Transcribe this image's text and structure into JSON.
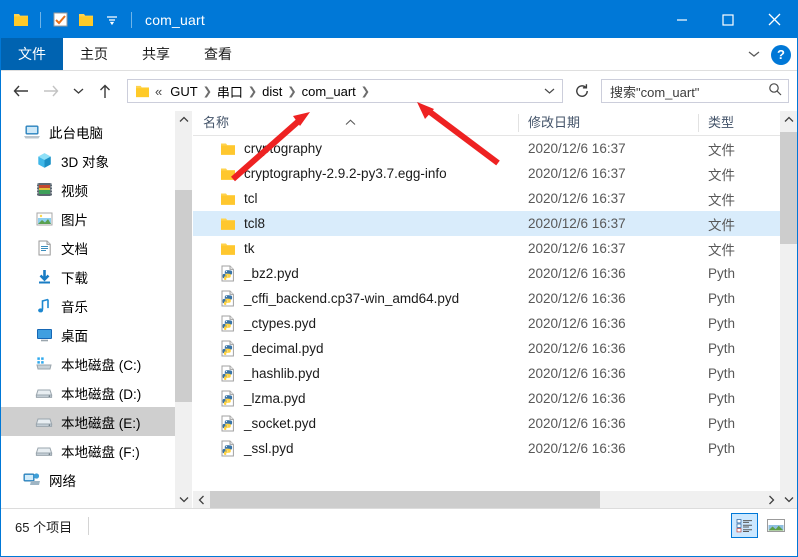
{
  "window": {
    "title": "com_uart",
    "quick_access": [
      {
        "name": "folder-icon",
        "label": "文件夹"
      },
      {
        "name": "properties-icon",
        "label": "属性"
      },
      {
        "name": "new-folder-icon",
        "label": "新建文件夹"
      },
      {
        "name": "customize-qat-icon",
        "label": "自定义快速访问工具栏"
      }
    ],
    "controls": {
      "minimize": "最小化",
      "maximize": "最大化",
      "close": "关闭"
    }
  },
  "ribbon": {
    "tabs": [
      {
        "label": "文件",
        "active": true
      },
      {
        "label": "主页",
        "active": false
      },
      {
        "label": "共享",
        "active": false
      },
      {
        "label": "查看",
        "active": false
      }
    ],
    "collapse_label": "折叠功能区",
    "help_label": "?"
  },
  "navbar": {
    "back": "后退",
    "forward": "前进",
    "recent": "最近使用的位置",
    "up": "向上",
    "refresh": "刷新",
    "breadcrumb": {
      "overflow": "«",
      "items": [
        "GUT",
        "串口",
        "dist",
        "com_uart"
      ]
    },
    "dropdown": "历史记录"
  },
  "search": {
    "placeholder": "搜索\"com_uart\"",
    "icon": "search-icon"
  },
  "sidebar": {
    "items": [
      {
        "label": "此台电脑",
        "icon": "computer-icon",
        "indent": 0,
        "selected": false
      },
      {
        "label": "3D 对象",
        "icon": "3d-objects-icon",
        "indent": 1,
        "selected": false
      },
      {
        "label": "视频",
        "icon": "videos-icon",
        "indent": 1,
        "selected": false
      },
      {
        "label": "图片",
        "icon": "pictures-icon",
        "indent": 1,
        "selected": false
      },
      {
        "label": "文档",
        "icon": "documents-icon",
        "indent": 1,
        "selected": false
      },
      {
        "label": "下载",
        "icon": "downloads-icon",
        "indent": 1,
        "selected": false
      },
      {
        "label": "音乐",
        "icon": "music-icon",
        "indent": 1,
        "selected": false
      },
      {
        "label": "桌面",
        "icon": "desktop-icon",
        "indent": 1,
        "selected": false
      },
      {
        "label": "本地磁盘 (C:)",
        "icon": "windows-drive-icon",
        "indent": 1,
        "selected": false
      },
      {
        "label": "本地磁盘 (D:)",
        "icon": "drive-icon",
        "indent": 1,
        "selected": false
      },
      {
        "label": "本地磁盘 (E:)",
        "icon": "drive-icon",
        "indent": 1,
        "selected": true
      },
      {
        "label": "本地磁盘 (F:)",
        "icon": "drive-icon",
        "indent": 1,
        "selected": false
      },
      {
        "label": "网络",
        "icon": "network-icon",
        "indent": 0,
        "selected": false
      }
    ]
  },
  "filelist": {
    "columns": [
      {
        "label": "名称",
        "key": "name",
        "sorted": "asc"
      },
      {
        "label": "修改日期",
        "key": "date"
      },
      {
        "label": "类型",
        "key": "type"
      }
    ],
    "rows": [
      {
        "name": "cryptography",
        "date": "2020/12/6 16:37",
        "type": "文件",
        "icon": "folder-icon",
        "selected": false
      },
      {
        "name": "cryptography-2.9.2-py3.7.egg-info",
        "date": "2020/12/6 16:37",
        "type": "文件",
        "icon": "folder-icon",
        "selected": false
      },
      {
        "name": "tcl",
        "date": "2020/12/6 16:37",
        "type": "文件",
        "icon": "folder-icon",
        "selected": false
      },
      {
        "name": "tcl8",
        "date": "2020/12/6 16:37",
        "type": "文件",
        "icon": "folder-icon",
        "selected": true
      },
      {
        "name": "tk",
        "date": "2020/12/6 16:37",
        "type": "文件",
        "icon": "folder-icon",
        "selected": false
      },
      {
        "name": "_bz2.pyd",
        "date": "2020/12/6 16:36",
        "type": "Pyth",
        "icon": "python-file-icon",
        "selected": false
      },
      {
        "name": "_cffi_backend.cp37-win_amd64.pyd",
        "date": "2020/12/6 16:36",
        "type": "Pyth",
        "icon": "python-file-icon",
        "selected": false
      },
      {
        "name": "_ctypes.pyd",
        "date": "2020/12/6 16:36",
        "type": "Pyth",
        "icon": "python-file-icon",
        "selected": false
      },
      {
        "name": "_decimal.pyd",
        "date": "2020/12/6 16:36",
        "type": "Pyth",
        "icon": "python-file-icon",
        "selected": false
      },
      {
        "name": "_hashlib.pyd",
        "date": "2020/12/6 16:36",
        "type": "Pyth",
        "icon": "python-file-icon",
        "selected": false
      },
      {
        "name": "_lzma.pyd",
        "date": "2020/12/6 16:36",
        "type": "Pyth",
        "icon": "python-file-icon",
        "selected": false
      },
      {
        "name": "_socket.pyd",
        "date": "2020/12/6 16:36",
        "type": "Pyth",
        "icon": "python-file-icon",
        "selected": false
      },
      {
        "name": "_ssl.pyd",
        "date": "2020/12/6 16:36",
        "type": "Pyth",
        "icon": "python-file-icon",
        "selected": false
      }
    ]
  },
  "statusbar": {
    "item_count": "65 个项目",
    "views": [
      {
        "name": "details-view-button",
        "label": "详细信息",
        "active": true
      },
      {
        "name": "large-icons-view-button",
        "label": "大图标",
        "active": false
      }
    ]
  },
  "annotations": {
    "color": "#ee2222",
    "arrows": [
      {
        "name": "arrow-pointing-to-dist",
        "target": "dist"
      },
      {
        "name": "arrow-pointing-to-com-uart",
        "target": "com_uart"
      }
    ]
  },
  "colors": {
    "title_bar": "#0078d7",
    "active_tab": "#0063b1",
    "selection_row": "#d9ecfb",
    "selection_nav": "#cfcfcf",
    "annotation": "#ee2222"
  }
}
